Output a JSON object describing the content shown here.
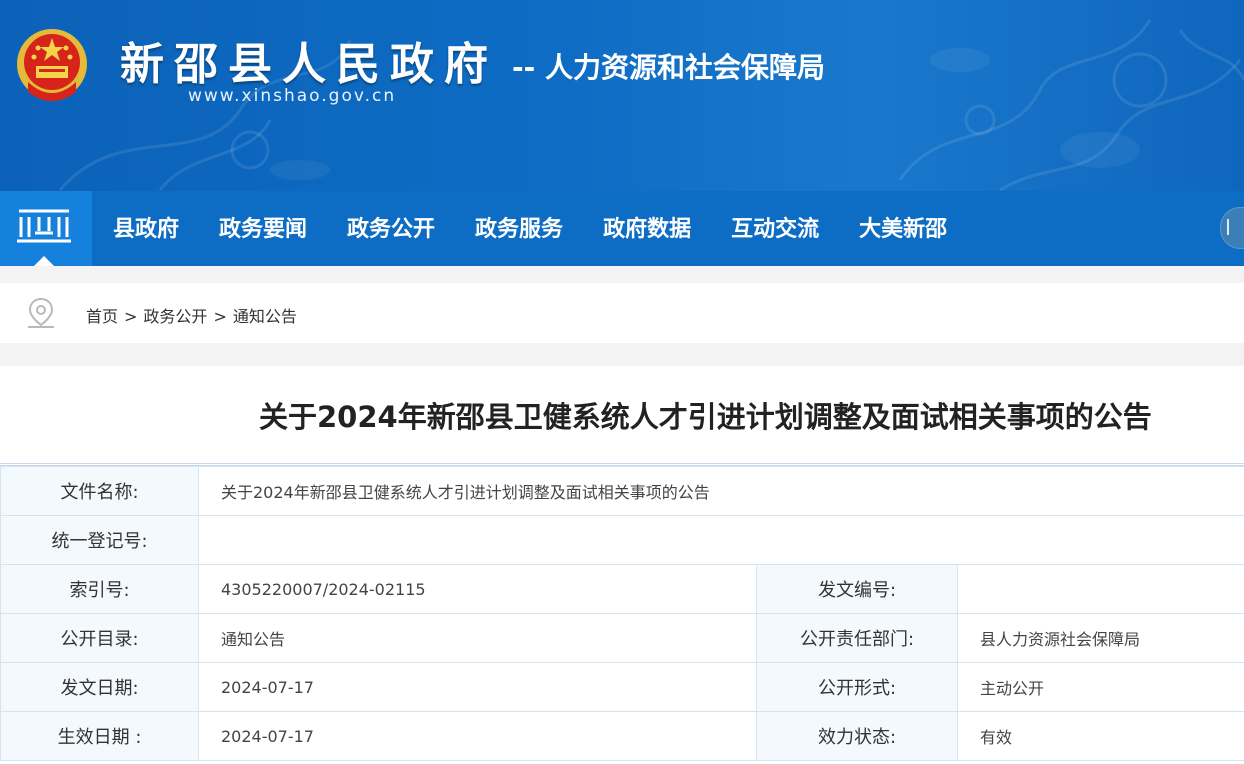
{
  "header": {
    "site_name": "新邵县人民政府",
    "site_url": "www.xinshao.gov.cn",
    "dept_name": "-- 人力资源和社会保障局"
  },
  "nav": {
    "items": [
      "县政府",
      "政务要闻",
      "政务公开",
      "政务服务",
      "政府数据",
      "互动交流",
      "大美新邵"
    ]
  },
  "breadcrumb": {
    "items": [
      "首页",
      "政务公开",
      "通知公告"
    ],
    "separator": ">"
  },
  "article": {
    "title": "关于2024年新邵县卫健系统人才引进计划调整及面试相关事项的公告"
  },
  "meta": {
    "file_name_label": "文件名称:",
    "file_name": "关于2024年新邵县卫健系统人才引进计划调整及面试相关事项的公告",
    "reg_no_label": "统一登记号:",
    "reg_no": "",
    "index_label": "索引号:",
    "index": "4305220007/2024-02115",
    "doc_no_label": "发文编号:",
    "doc_no": "",
    "catalog_label": "公开目录:",
    "catalog": "通知公告",
    "dept_label": "公开责任部门:",
    "dept": "县人力资源社会保障局",
    "issue_date_label": "发文日期:",
    "issue_date": "2024-07-17",
    "form_label": "公开形式:",
    "form": "主动公开",
    "effective_date_label": "生效日期 :",
    "effective_date": "2024-07-17",
    "status_label": "效力状态:",
    "status": "有效"
  },
  "colors": {
    "banner": "#0e6cc4",
    "nav": "#0d6cc3",
    "nav_home": "#1681dc",
    "label_bg": "#f4f9fd",
    "border": "#d3e4f3"
  }
}
